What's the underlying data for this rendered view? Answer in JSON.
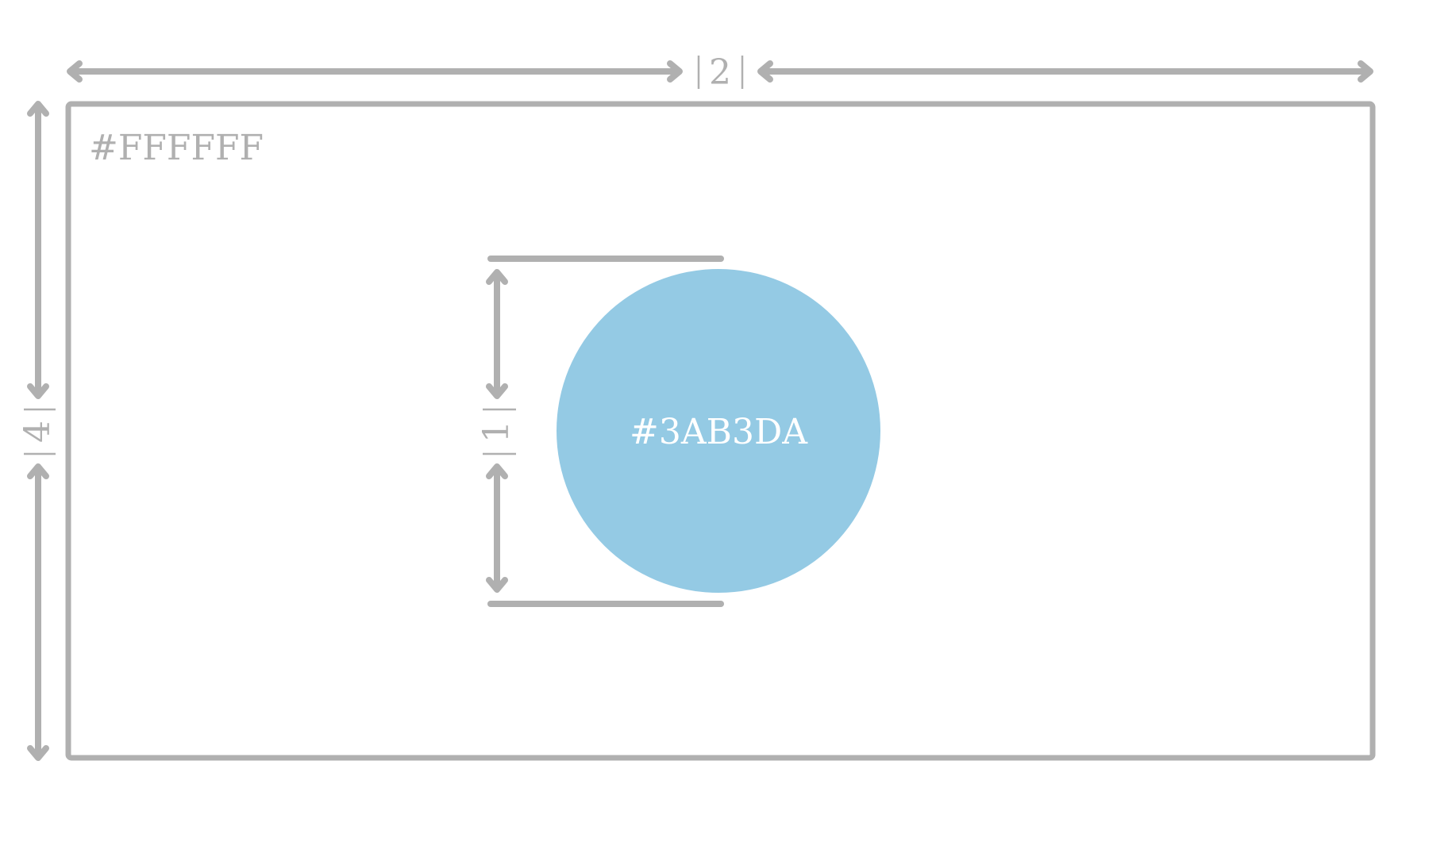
{
  "canvas": {
    "background_label": "#FFFFFF",
    "background_color": "#FFFFFF"
  },
  "circle": {
    "color_label": "#3AB3DA",
    "fill_color": "#94CAE4",
    "text_color": "#FFFFFF"
  },
  "dimensions": {
    "width_label": "2",
    "height_label": "4",
    "circle_diameter_label": "1"
  },
  "style": {
    "annotation_color": "#B0B0B0"
  }
}
